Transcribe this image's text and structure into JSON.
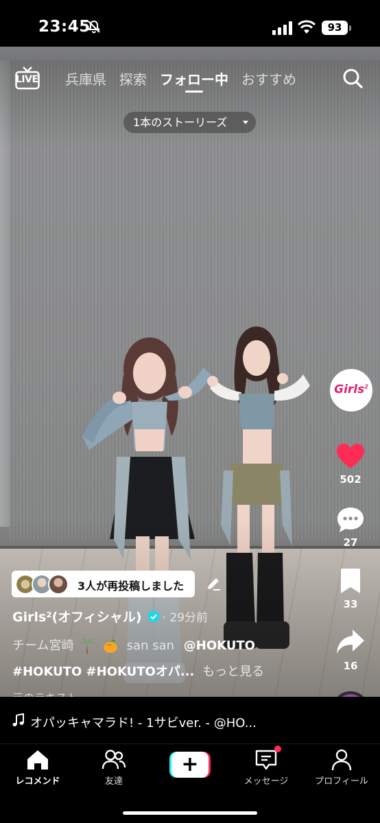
{
  "status_bar": {
    "time": "23:45",
    "battery": "93",
    "icons": [
      "silent-mode-icon",
      "signal-icon",
      "wifi-icon",
      "battery-icon"
    ]
  },
  "top_nav": {
    "live_label": "LIVE",
    "tabs": [
      {
        "label": "兵庫県",
        "active": false
      },
      {
        "label": "探索",
        "active": false
      },
      {
        "label": "フォロー中",
        "active": true
      },
      {
        "label": "おすすめ",
        "active": false
      }
    ],
    "search_icon": "search-icon"
  },
  "stories": {
    "label": "1本のストーリーズ"
  },
  "rail": {
    "profile_logo": "Girls",
    "profile_logo_sup": "2",
    "likes": "502",
    "comments": "27",
    "saves": "33",
    "shares": "16"
  },
  "repost": {
    "text": "3人が再投稿しました"
  },
  "post": {
    "author": "Girls²(オフィシャル)",
    "time": "· 29分前",
    "caption_prefix": "チーム宮崎",
    "caption_names": "san san",
    "caption_mention": "@HOKUTO",
    "caption_tags": "#HOKUTO #HOKUTOオパ...",
    "more": "もっと見る",
    "original_text": "元のテキスト"
  },
  "sound": {
    "title": "オパッキャマラド! - 1サビver. - @HO..."
  },
  "bottom_nav": {
    "items": [
      {
        "label": "レコメンド",
        "icon": "home-icon",
        "active": true
      },
      {
        "label": "友達",
        "icon": "friends-icon",
        "active": false
      },
      {
        "label": "+",
        "icon": "plus-icon",
        "active": false
      },
      {
        "label": "メッセージ",
        "icon": "inbox-icon",
        "active": false
      },
      {
        "label": "プロフィール",
        "icon": "profile-icon",
        "active": false
      }
    ]
  },
  "colors": {
    "like_red": "#fe2c55",
    "accent_cyan": "#25f4ee",
    "verified_blue": "#20d5ec",
    "girls_logo_pink": "#e2226c"
  }
}
